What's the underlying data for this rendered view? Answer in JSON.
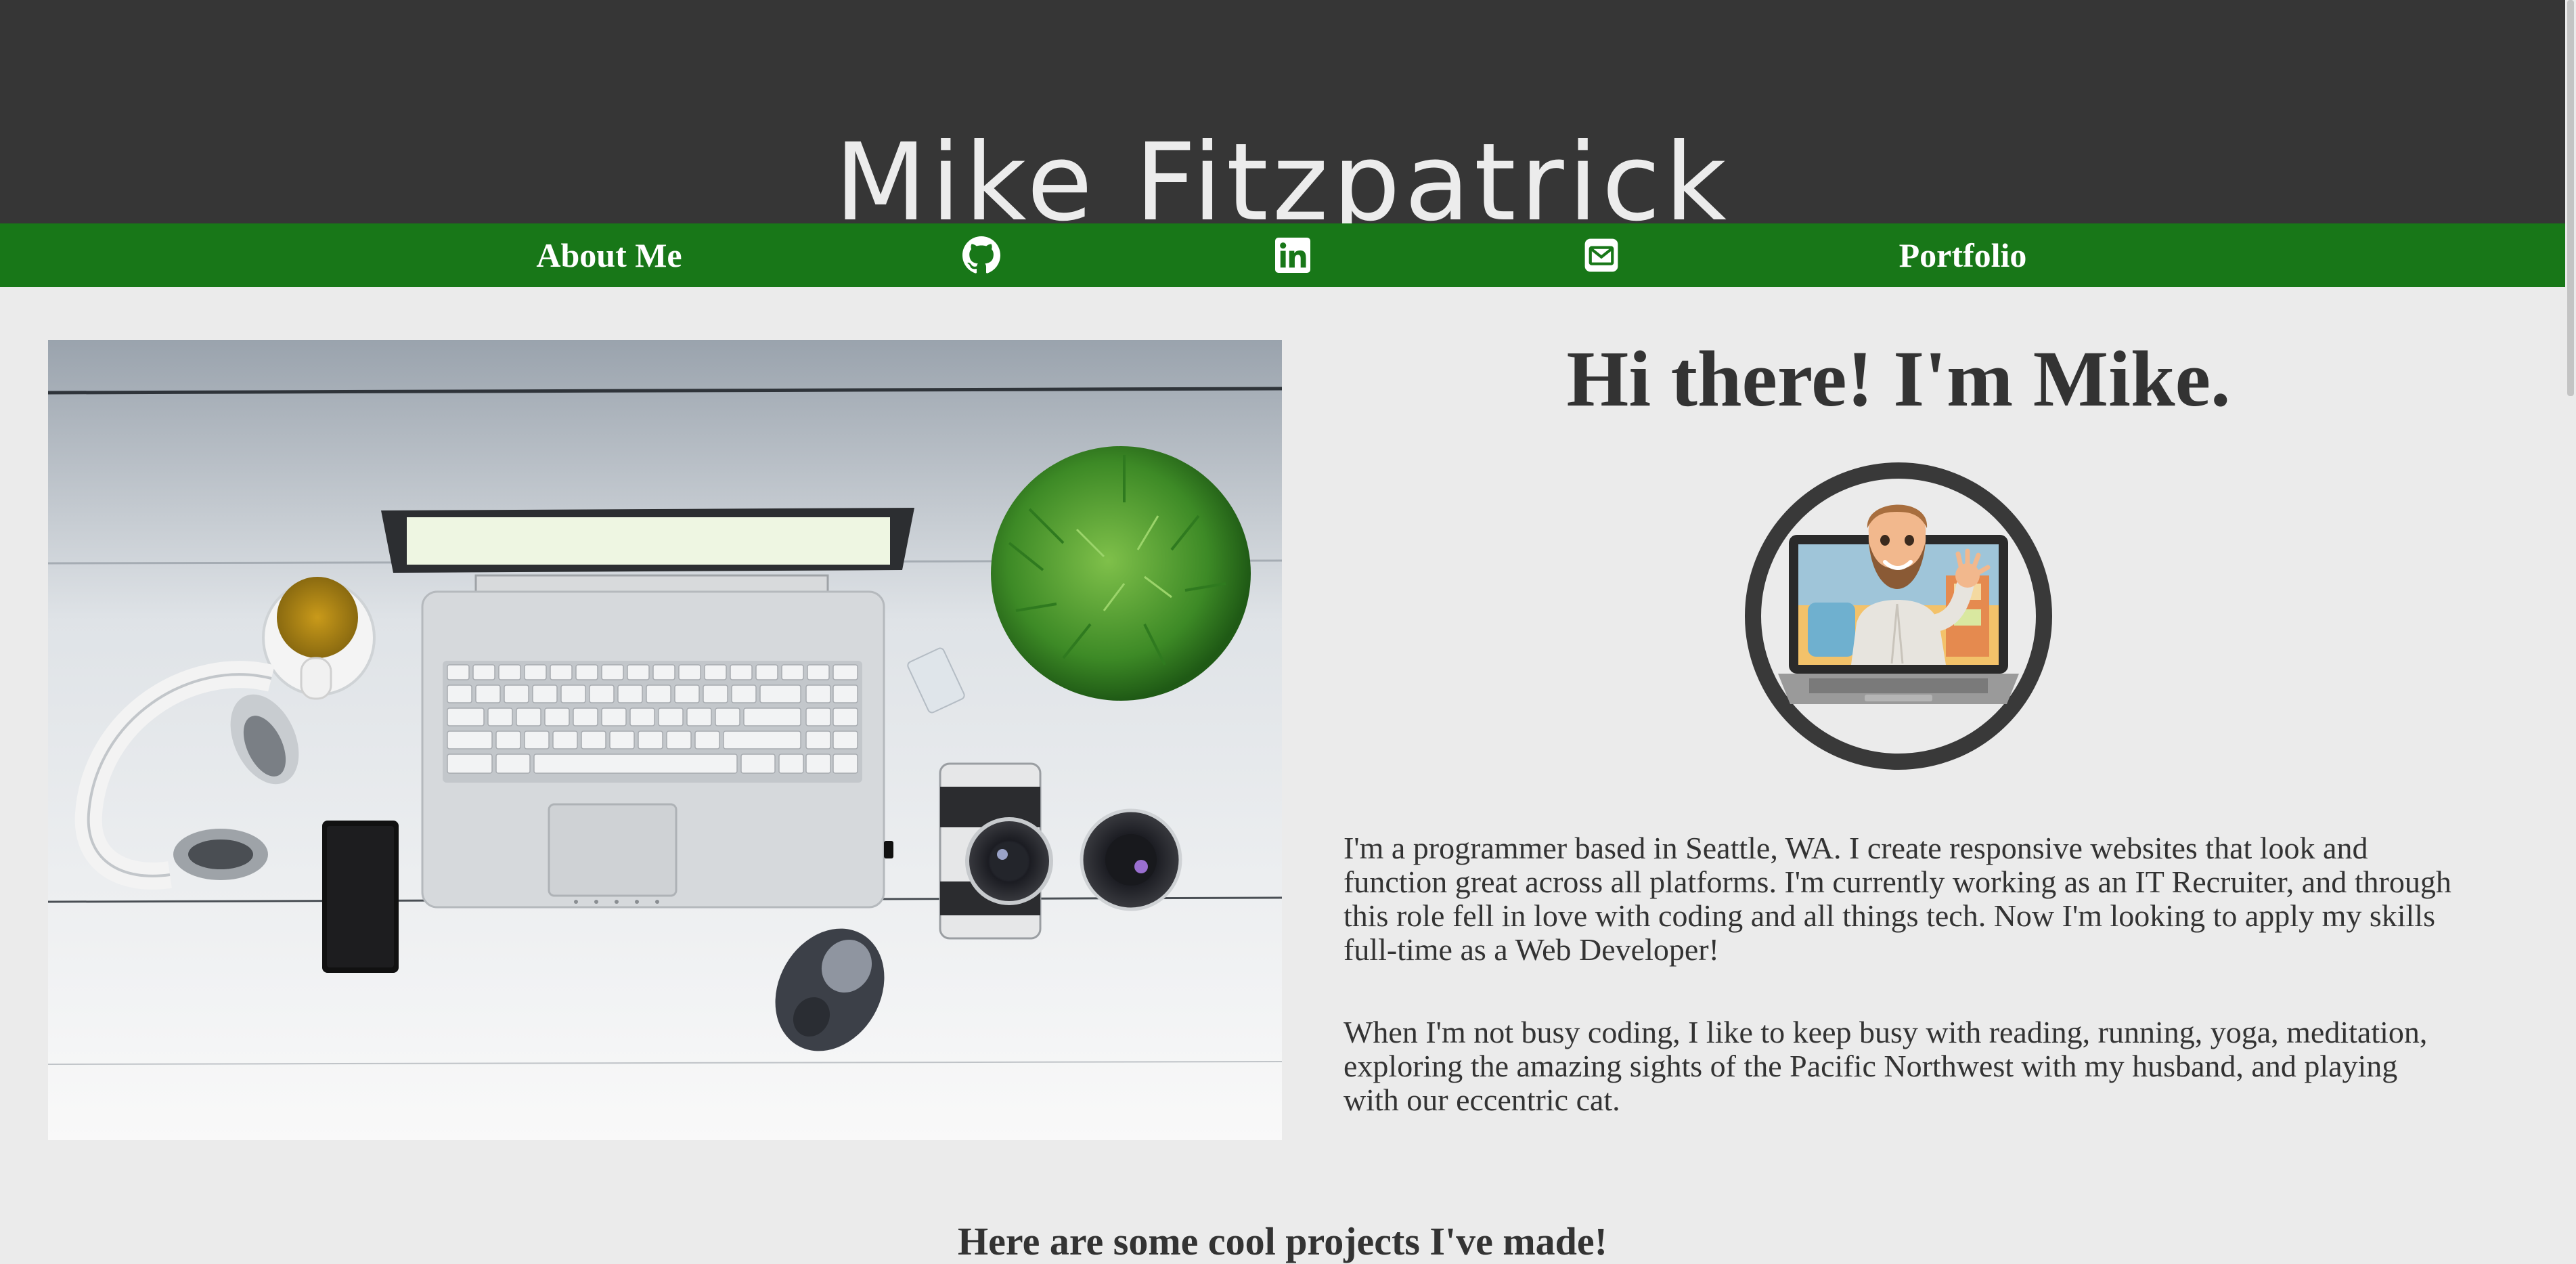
{
  "header": {
    "title": "Mike Fitzpatrick"
  },
  "nav": {
    "about_label": "About Me",
    "github_icon": "github-icon",
    "linkedin_icon": "linkedin-icon",
    "email_icon": "envelope-icon",
    "portfolio_label": "Portfolio"
  },
  "main": {
    "greeting": "Hi there! I'm Mike.",
    "bio_paragraph_1": "I'm a programmer based in Seattle, WA. I create responsive websites that look and function great across all platforms. I'm currently working as an IT Recruiter, and through this role fell in love with coding and all things tech. Now I'm looking to apply my skills full-time as a Web Developer!",
    "bio_paragraph_2": "When I'm not busy coding, I like to keep busy with reading, running, yoga, meditation, exploring the amazing sights of the Pacific Northwest with my husband, and playing with our eccentric cat."
  },
  "projects": {
    "heading": "Here are some cool projects I've made!"
  },
  "colors": {
    "header_bg": "#363636",
    "nav_bg": "#187718",
    "page_bg": "#ebebeb",
    "text": "#333333"
  }
}
